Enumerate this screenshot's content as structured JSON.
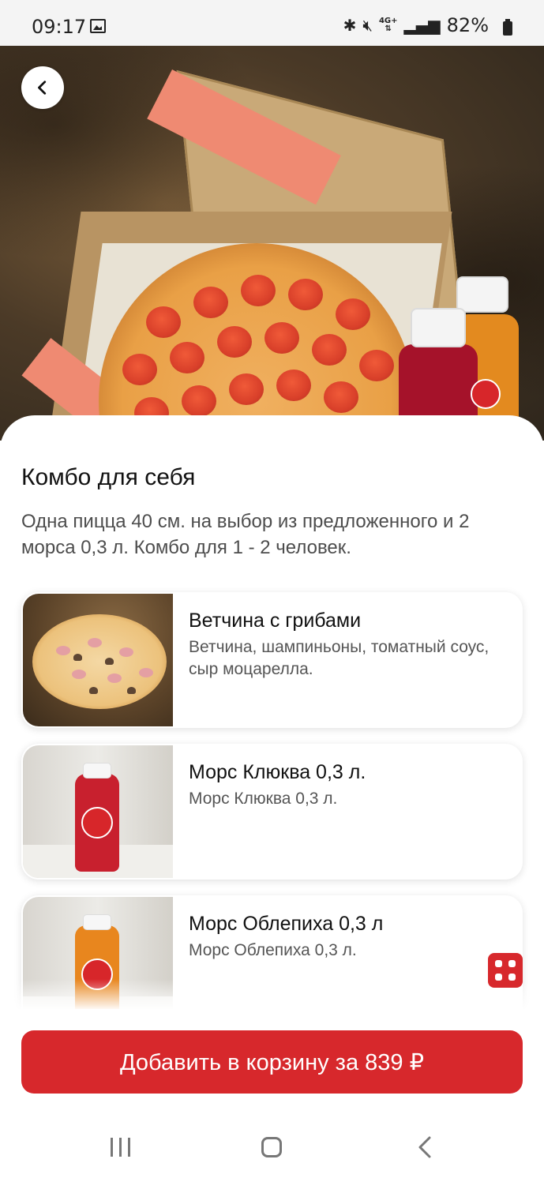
{
  "status_bar": {
    "time": "09:17",
    "battery": "82%",
    "icons": [
      "gallery-icon",
      "bluetooth-icon",
      "mute-icon",
      "4g-icon",
      "signal-icon",
      "battery-icon"
    ]
  },
  "product": {
    "title": "Комбо для себя",
    "description": "Одна пицца 40 см. на выбор из предложенного и 2 морса 0,3 л. Комбо для 1 - 2 человек."
  },
  "items": [
    {
      "name": "Ветчина с грибами",
      "description": "Ветчина, шампиньоны, томатный соус, сыр моцарелла.",
      "image": "pizza-ham-mushroom"
    },
    {
      "name": "Морс Клюква 0,3 л.",
      "description": "Морс Клюква 0,3 л.",
      "image": "cranberry-drink",
      "color": "#c8202e"
    },
    {
      "name": "Морс Облепиха 0,3 л",
      "description": "Морс Облепиха 0,3 л.",
      "image": "sea-buckthorn-drink",
      "color": "#e8861e"
    }
  ],
  "cart_button": {
    "label": "Добавить в корзину за 839 ₽"
  },
  "colors": {
    "accent": "#d7282c"
  }
}
